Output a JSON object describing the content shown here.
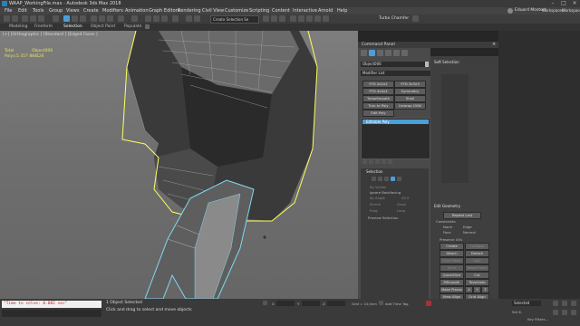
{
  "window": {
    "title": "WAAP_WorkingFile.max - Autodesk 3ds Max 2018"
  },
  "menubar": {
    "items": [
      "File",
      "Edit",
      "Tools",
      "Group",
      "Views",
      "Create",
      "Modifiers",
      "Animation",
      "Graph Editors",
      "Rendering",
      "Civil View",
      "Customize",
      "Scripting",
      "Content",
      "Interactive",
      "Arnold",
      "Help"
    ]
  },
  "toolbar": {
    "selection_set": "Create Selection Se",
    "user": "Eduard Mostert",
    "workspaces_label": "Workspaces:",
    "workspace_value": "Workspace_1",
    "turbo_label": "Turbo Chamfer"
  },
  "ribbon": {
    "tabs": [
      "Modeling",
      "Freeform",
      "Selection",
      "Object Paint",
      "Populate"
    ]
  },
  "viewport": {
    "label": "[+] [Orthographic ] [Standard ] [Edged Faces ]",
    "stats": {
      "total_label": "Total",
      "object_label": "Object006",
      "polys_label": "Polys:",
      "polys_total": "5 357 884",
      "polys_object": "126"
    }
  },
  "command_panel": {
    "title": "Command Panel",
    "object_name": "Object006",
    "modifier_list": "Modifier List",
    "buttons": [
      "FFD 2x2x2",
      "FFD 3x3x3",
      "FFD 4x4x4",
      "Symmetry",
      "TurboSmooth",
      "Shell",
      "Turn to Poly",
      "Unwrap UVW",
      "Edit Poly"
    ],
    "stack_item": "Editable Poly",
    "selection": {
      "header": "Selection",
      "by_vertex": "By Vertex",
      "ignore_backfacing": "Ignore Backfacing",
      "by_angle": "By Angle",
      "angle_value": "45.0",
      "shrink": "Shrink",
      "grow": "Grow",
      "ring": "Ring",
      "loop": "Loop",
      "preview": "Preview Selection"
    }
  },
  "right_panel": {
    "soft_selection": "Soft Selection",
    "edit_geometry": "Edit Geometry",
    "repeat_last": "Repeat Last",
    "constraints": "Constraints",
    "none": "None",
    "edge": "Edge",
    "face": "Face",
    "normal": "Normal",
    "preserve_uvs": "Preserve UVs",
    "create": "Create",
    "collapse": "Collapse",
    "attach": "Attach",
    "detach": "Detach",
    "slice_plane": "Slice Plane",
    "split": "Split",
    "slice": "Slice",
    "reset_plane": "Reset Plane",
    "quickslice": "QuickSlice",
    "cut": "Cut",
    "msmooth": "MSmooth",
    "tessellate": "Tessellate",
    "make_planar": "Make Planar",
    "x": "X",
    "y": "Y",
    "z": "Z",
    "view_align": "View Align",
    "grid_align": "Grid Align",
    "relax": "Relax"
  },
  "statusbar": {
    "script_output": "\"Time to solve: 0.002 sec\"",
    "objects_selected": "1 Object Selected",
    "prompt": "Click and drag to select and move objects",
    "x_label": "X",
    "y_label": "Y",
    "z_label": "Z",
    "grid": "Grid = 10,0cm",
    "add_time_tag": "Add Time Tag",
    "selected": "Selected",
    "set_key": "Set K.",
    "key_filters": "Key Filters..."
  },
  "colors": {
    "accent_blue": "#4a9fd8",
    "selection_yellow": "#ffff60",
    "selection_cyan": "#7fd8f0"
  }
}
